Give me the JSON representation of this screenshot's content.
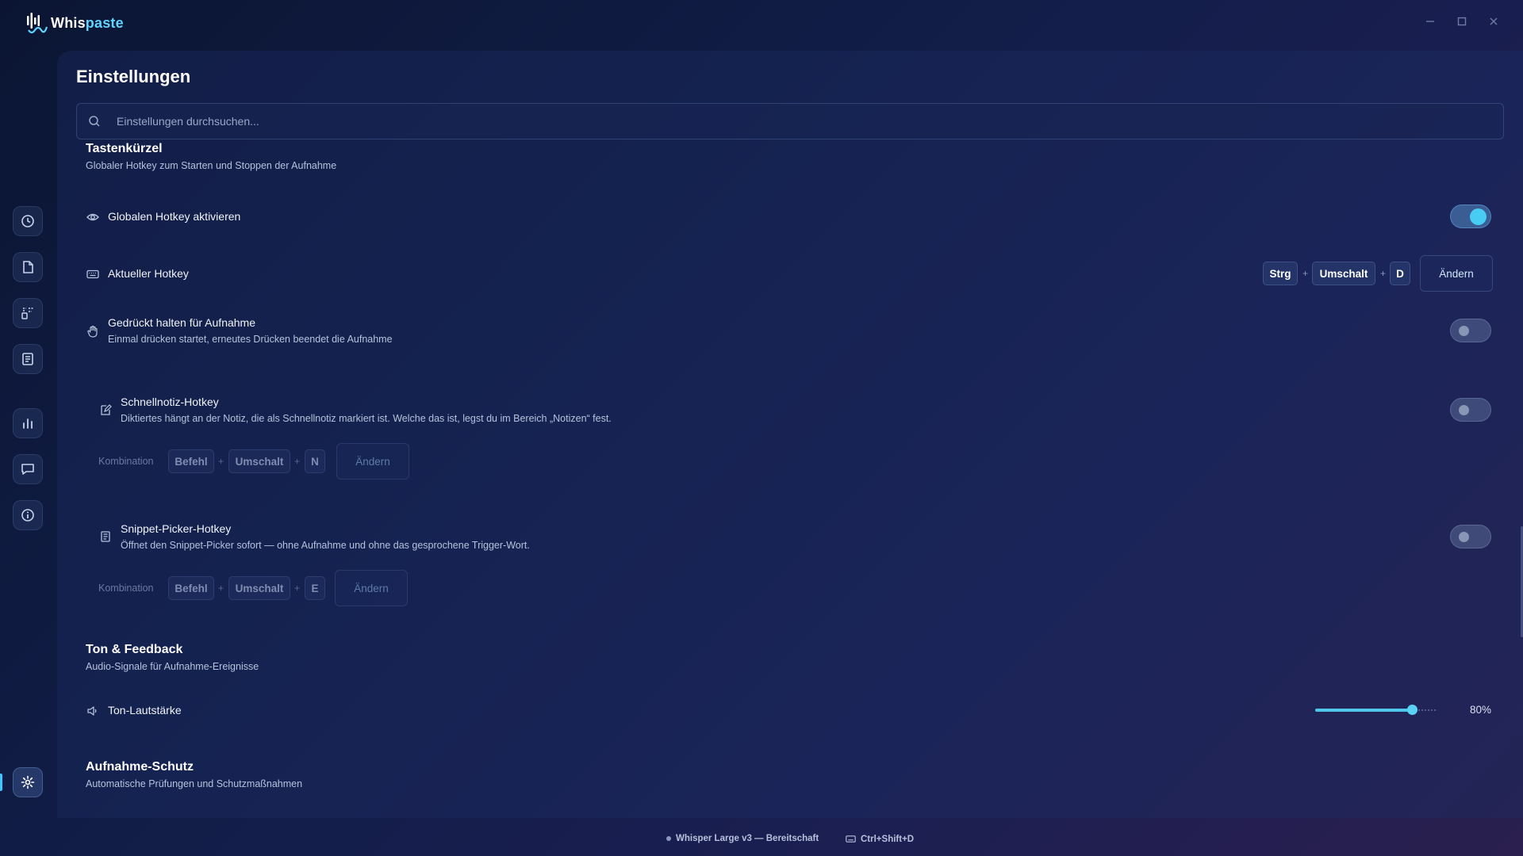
{
  "app": {
    "name_prefix": "Whis",
    "name_suffix": "paste"
  },
  "window_controls": {
    "minimize": "minimize-icon",
    "maximize": "maximize-icon",
    "close": "close-icon"
  },
  "sidebar": {
    "items": [
      {
        "name": "history",
        "icon": "clock-icon"
      },
      {
        "name": "documents",
        "icon": "document-icon"
      },
      {
        "name": "snippets",
        "icon": "snippets-icon"
      },
      {
        "name": "notes",
        "icon": "notes-icon"
      },
      {
        "name": "statistics",
        "icon": "bar-chart-icon"
      },
      {
        "name": "feedback",
        "icon": "chat-icon"
      },
      {
        "name": "info",
        "icon": "info-icon"
      },
      {
        "name": "settings",
        "icon": "gear-icon",
        "active": true
      }
    ]
  },
  "page": {
    "title": "Einstellungen",
    "search_placeholder": "Einstellungen durchsuchen..."
  },
  "hotkeys": {
    "title": "Tastenkürzel",
    "subtitle": "Globaler Hotkey zum Starten und Stoppen der Aufnahme",
    "global_hotkey": {
      "label": "Globalen Hotkey aktivieren",
      "enabled": true
    },
    "current_hotkey": {
      "label": "Aktueller Hotkey",
      "keys": [
        "Strg",
        "Umschalt",
        "D"
      ],
      "plus": "+",
      "change_label": "Ändern"
    },
    "push_to_talk": {
      "label": "Gedrückt halten für Aufnahme",
      "description": "Einmal drücken startet, erneutes Drücken beendet die Aufnahme",
      "enabled": false
    },
    "quicknote": {
      "label": "Schnellnotiz-Hotkey",
      "description": "Diktiertes hängt an der Notiz, die als Schnellnotiz markiert ist. Welche das ist, legst du im Bereich „Notizen“ fest.",
      "enabled": false,
      "combo_label": "Kombination",
      "keys": [
        "Befehl",
        "Umschalt",
        "N"
      ],
      "change_label": "Ändern"
    },
    "snippet_picker": {
      "label": "Snippet-Picker-Hotkey",
      "description": "Öffnet den Snippet-Picker sofort — ohne Aufnahme und ohne das gesprochene Trigger-Wort.",
      "enabled": false,
      "combo_label": "Kombination",
      "keys": [
        "Befehl",
        "Umschalt",
        "E"
      ],
      "change_label": "Ändern"
    }
  },
  "sound": {
    "title": "Ton & Feedback",
    "subtitle": "Audio-Signale für Aufnahme-Ereignisse",
    "volume": {
      "label": "Ton-Lautstärke",
      "value": 80,
      "value_text": "80%"
    }
  },
  "protection": {
    "title": "Aufnahme-Schutz",
    "subtitle": "Automatische Prüfungen und Schutzmaßnahmen"
  },
  "statusbar": {
    "model_status": "Whisper Large v3 — Bereitschaft",
    "hotkey": "Ctrl+Shift+D"
  },
  "colors": {
    "accent": "#49ccf3",
    "background": "#111d47"
  }
}
